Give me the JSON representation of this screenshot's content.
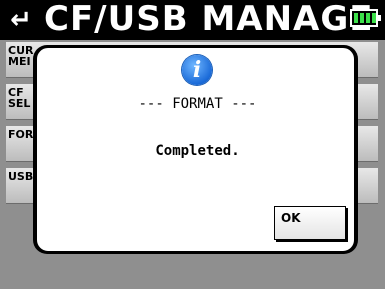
{
  "header": {
    "back_icon": "return-arrow-icon",
    "back_glyph": "↵",
    "title": "CF/USB MANAGE",
    "battery_icon": "battery-full-icon",
    "battery_color": "#3de04a"
  },
  "menu": {
    "items": [
      {
        "label": "CUR\nMEI"
      },
      {
        "label": "CF\nSEL"
      },
      {
        "label": "FOR"
      },
      {
        "label": "USB"
      }
    ]
  },
  "dialog": {
    "icon": "info-icon",
    "icon_glyph": "i",
    "icon_color": "#1a6ad8",
    "heading": "--- FORMAT ---",
    "message": "Completed.",
    "ok_label": "OK"
  }
}
